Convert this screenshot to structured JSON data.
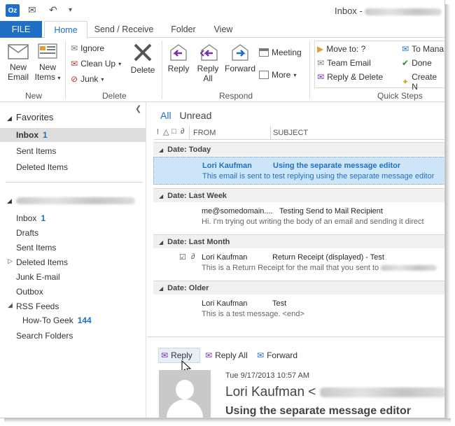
{
  "title": {
    "app_icon": "Oz",
    "text": "Inbox -"
  },
  "tabs": [
    "FILE",
    "Home",
    "Send / Receive",
    "Folder",
    "View"
  ],
  "ribbon": {
    "new_group": {
      "label": "New",
      "new_email": [
        "New",
        "Email"
      ],
      "new_items": [
        "New",
        "Items"
      ]
    },
    "delete_group": {
      "label": "Delete",
      "ignore": "Ignore",
      "clean_up": "Clean Up",
      "junk": "Junk",
      "delete": "Delete"
    },
    "respond_group": {
      "label": "Respond",
      "reply": "Reply",
      "reply_all": [
        "Reply",
        "All"
      ],
      "forward": "Forward",
      "meeting": "Meeting",
      "more": "More"
    },
    "quick_steps": {
      "label": "Quick Steps",
      "move_to": "Move to: ?",
      "team_email": "Team Email",
      "reply_delete": "Reply & Delete",
      "to_manager": "To Mana",
      "done": "Done",
      "create_new": "Create N"
    }
  },
  "sidebar": {
    "favorites_label": "Favorites",
    "favorites": [
      {
        "label": "Inbox",
        "count": "1"
      },
      {
        "label": "Sent Items",
        "count": ""
      },
      {
        "label": "Deleted Items",
        "count": ""
      }
    ],
    "account_items": [
      {
        "label": "Inbox",
        "count": "1"
      },
      {
        "label": "Drafts",
        "count": ""
      },
      {
        "label": "Sent Items",
        "count": ""
      },
      {
        "label": "Deleted Items",
        "count": ""
      },
      {
        "label": "Junk E-mail",
        "count": ""
      },
      {
        "label": "Outbox",
        "count": ""
      },
      {
        "label": "RSS Feeds",
        "count": ""
      },
      {
        "label": "How-To Geek",
        "count": "144"
      },
      {
        "label": "Search Folders",
        "count": ""
      }
    ]
  },
  "list": {
    "filter_all": "All",
    "filter_unread": "Unread",
    "col_from": "FROM",
    "col_subject": "SUBJECT",
    "groups": [
      {
        "header": "Date: Today",
        "messages": [
          {
            "from": "Lori Kaufman",
            "subject": "Using the separate message editor",
            "preview": "This email is sent to test replying using the separate message editor"
          }
        ]
      },
      {
        "header": "Date: Last Week",
        "messages": [
          {
            "from": "me@somedomain....",
            "subject": "Testing Send to Mail Recipient",
            "preview": "Hi. I'm trying out writing the body of an email and sending it direct"
          }
        ]
      },
      {
        "header": "Date: Last Month",
        "messages": [
          {
            "from": "Lori Kaufman",
            "subject": "Return Receipt (displayed) - Test",
            "preview": "This is a Return Receipt for the mail that you sent to"
          }
        ]
      },
      {
        "header": "Date: Older",
        "messages": [
          {
            "from": "Lori Kaufman",
            "subject": "Test",
            "preview": "This is a test message. <end>"
          }
        ]
      }
    ]
  },
  "reading": {
    "reply": "Reply",
    "reply_all": "Reply All",
    "forward": "Forward",
    "date": "Tue 9/17/2013 10:57 AM",
    "sender": "Lori Kaufman <",
    "subject": "Using the separate message editor"
  },
  "colors": {
    "accent": "#1f6fc5",
    "selection": "#cde6f7"
  }
}
